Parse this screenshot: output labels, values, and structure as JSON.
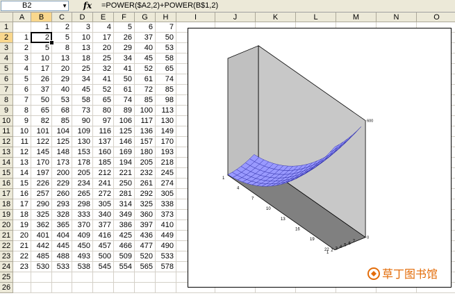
{
  "formula_bar": {
    "name_box": "B2",
    "fx_label": "fx",
    "formula": "=POWER($A2,2)+POWER(B$1,2)"
  },
  "columns": [
    "A",
    "B",
    "C",
    "D",
    "E",
    "F",
    "G",
    "H",
    "I",
    "J",
    "K",
    "L",
    "M",
    "N",
    "O"
  ],
  "rows": [
    "1",
    "2",
    "3",
    "4",
    "5",
    "6",
    "7",
    "8",
    "9",
    "10",
    "11",
    "12",
    "13",
    "14",
    "15",
    "16",
    "17",
    "18",
    "19",
    "20",
    "21",
    "22",
    "23",
    "24",
    "25",
    "26"
  ],
  "sheet_values": [
    [
      "",
      "1",
      "2",
      "3",
      "4",
      "5",
      "6",
      "7"
    ],
    [
      "1",
      "2",
      "5",
      "10",
      "17",
      "26",
      "37",
      "50"
    ],
    [
      "2",
      "5",
      "8",
      "13",
      "20",
      "29",
      "40",
      "53"
    ],
    [
      "3",
      "10",
      "13",
      "18",
      "25",
      "34",
      "45",
      "58"
    ],
    [
      "4",
      "17",
      "20",
      "25",
      "32",
      "41",
      "52",
      "65"
    ],
    [
      "5",
      "26",
      "29",
      "34",
      "41",
      "50",
      "61",
      "74"
    ],
    [
      "6",
      "37",
      "40",
      "45",
      "52",
      "61",
      "72",
      "85"
    ],
    [
      "7",
      "50",
      "53",
      "58",
      "65",
      "74",
      "85",
      "98"
    ],
    [
      "8",
      "65",
      "68",
      "73",
      "80",
      "89",
      "100",
      "113"
    ],
    [
      "9",
      "82",
      "85",
      "90",
      "97",
      "106",
      "117",
      "130"
    ],
    [
      "10",
      "101",
      "104",
      "109",
      "116",
      "125",
      "136",
      "149"
    ],
    [
      "11",
      "122",
      "125",
      "130",
      "137",
      "146",
      "157",
      "170"
    ],
    [
      "12",
      "145",
      "148",
      "153",
      "160",
      "169",
      "180",
      "193"
    ],
    [
      "13",
      "170",
      "173",
      "178",
      "185",
      "194",
      "205",
      "218"
    ],
    [
      "14",
      "197",
      "200",
      "205",
      "212",
      "221",
      "232",
      "245"
    ],
    [
      "15",
      "226",
      "229",
      "234",
      "241",
      "250",
      "261",
      "274"
    ],
    [
      "16",
      "257",
      "260",
      "265",
      "272",
      "281",
      "292",
      "305"
    ],
    [
      "17",
      "290",
      "293",
      "298",
      "305",
      "314",
      "325",
      "338"
    ],
    [
      "18",
      "325",
      "328",
      "333",
      "340",
      "349",
      "360",
      "373"
    ],
    [
      "19",
      "362",
      "365",
      "370",
      "377",
      "386",
      "397",
      "410"
    ],
    [
      "20",
      "401",
      "404",
      "409",
      "416",
      "425",
      "436",
      "449"
    ],
    [
      "21",
      "442",
      "445",
      "450",
      "457",
      "466",
      "477",
      "490"
    ],
    [
      "22",
      "485",
      "488",
      "493",
      "500",
      "509",
      "520",
      "533"
    ],
    [
      "23",
      "530",
      "533",
      "538",
      "545",
      "554",
      "565",
      "578"
    ],
    [
      "",
      "",
      "",
      "",
      "",
      "",
      "",
      ""
    ],
    [
      "",
      "",
      "",
      "",
      "",
      "",
      "",
      ""
    ]
  ],
  "selected_cell": "B2",
  "chart_data": {
    "type": "surface",
    "z_formula": "A^2 + B^2",
    "depth_ticks": [
      "1",
      "4",
      "7",
      "10",
      "13",
      "16",
      "19",
      "22"
    ],
    "series_ticks": [
      "1",
      "2",
      "3",
      "4",
      "5",
      "6",
      "7"
    ],
    "z_tick_max": "600",
    "z_tick_min": "0",
    "surface_color": "#9999ff",
    "wall_color": "#c0c0c0",
    "floor_color": "#808080"
  },
  "watermark": {
    "text": "草丁图书馆",
    "color": "#e36c09"
  }
}
